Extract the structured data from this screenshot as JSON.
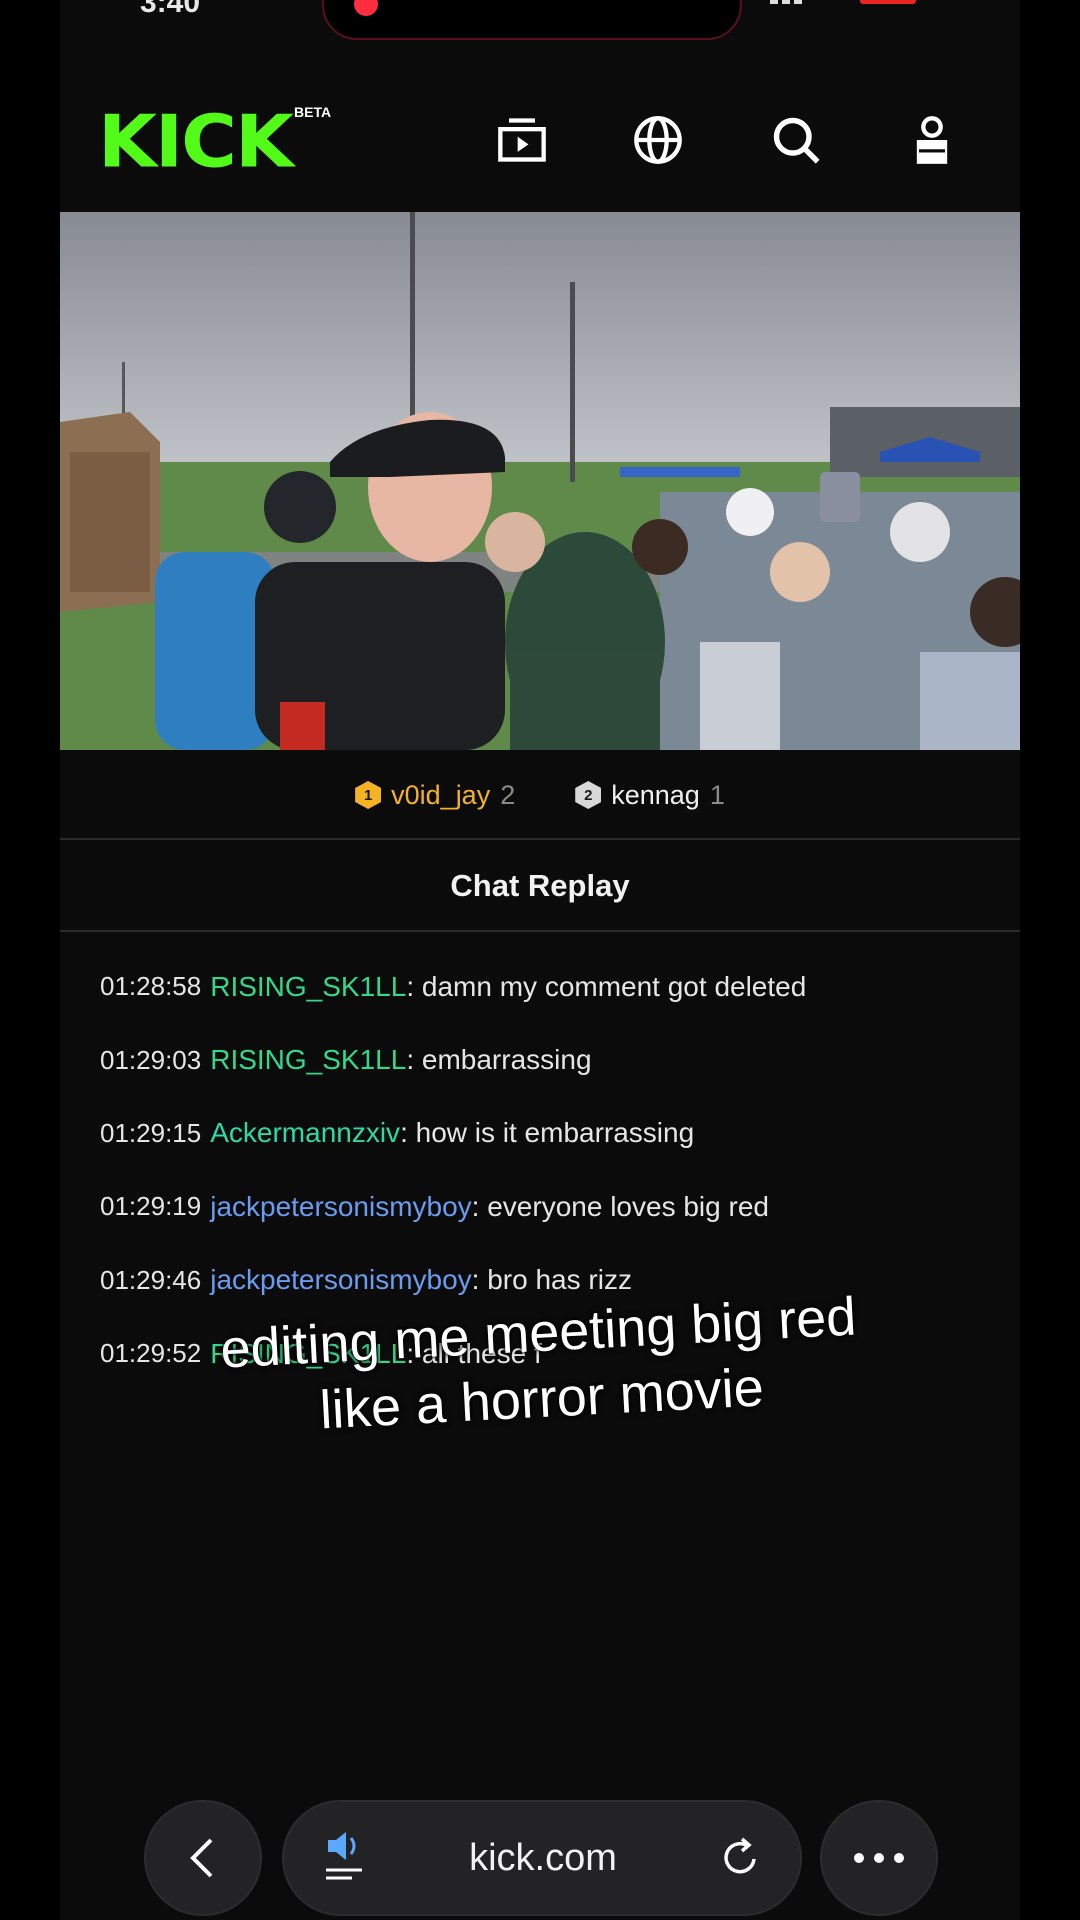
{
  "status_bar": {
    "time": "3:40"
  },
  "header": {
    "logo": "KICK",
    "beta_badge": "BETA",
    "icons": [
      "browse-icon",
      "globe-icon",
      "search-icon",
      "user-icon"
    ]
  },
  "leaderboard": [
    {
      "rank": "1",
      "name": "v0id_jay",
      "count": "2",
      "color": "#f5b324"
    },
    {
      "rank": "2",
      "name": "kennag",
      "count": "1",
      "color": "#f0f0f0"
    }
  ],
  "chat_title": "Chat Replay",
  "messages": [
    {
      "time": "01:28:58",
      "user": "RISING_SK1LL",
      "user_color": "#31d98a",
      "text": "damn my comment got deleted"
    },
    {
      "time": "01:29:03",
      "user": "RISING_SK1LL",
      "user_color": "#31d98a",
      "text": "embarrassing"
    },
    {
      "time": "01:29:15",
      "user": "Ackermannzxiv",
      "user_color": "#2fd9a3",
      "text": "how is it embarrassing"
    },
    {
      "time": "01:29:19",
      "user": "jackpetersonismyboy",
      "user_color": "#6a9cf0",
      "text": "everyone loves big red"
    },
    {
      "time": "01:29:46",
      "user": "jackpetersonismyboy",
      "user_color": "#6a9cf0",
      "text": "bro has rizz"
    },
    {
      "time": "01:29:52",
      "user": "RISING_SK1LL",
      "user_color": "#31d98a",
      "text": "all these f"
    }
  ],
  "caption": {
    "line1": "editing me meeting big red",
    "line2": "like a horror movie"
  },
  "browser_bar": {
    "url": "kick.com"
  },
  "colors": {
    "brand": "#53fc18",
    "background": "#0b0b0c"
  }
}
